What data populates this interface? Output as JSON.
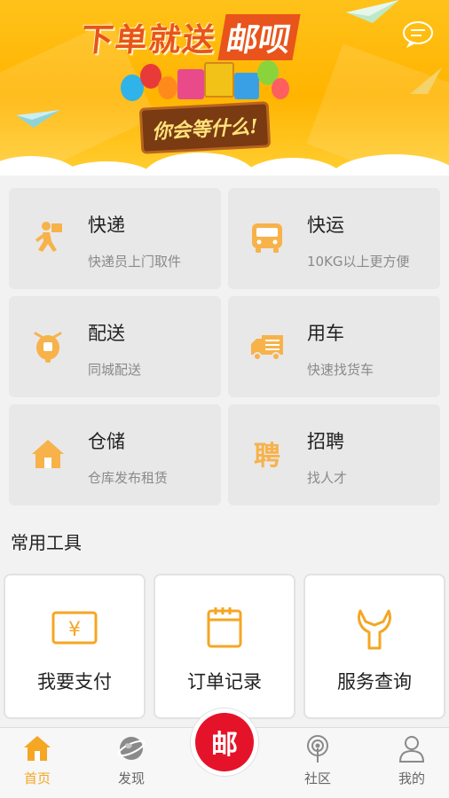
{
  "banner": {
    "title_part1": "下单就送",
    "title_part2": "邮呗",
    "board_text": "你会等什么!"
  },
  "services": [
    {
      "title": "快递",
      "subtitle": "快递员上门取件",
      "icon": "courier-icon"
    },
    {
      "title": "快运",
      "subtitle": "10KG以上更方便",
      "icon": "bus-icon"
    },
    {
      "title": "配送",
      "subtitle": "同城配送",
      "icon": "scooter-icon"
    },
    {
      "title": "用车",
      "subtitle": "快速找货车",
      "icon": "truck-icon"
    },
    {
      "title": "仓储",
      "subtitle": "仓库发布租赁",
      "icon": "house-icon"
    },
    {
      "title": "招聘",
      "subtitle": "找人才",
      "icon": "hire-icon"
    }
  ],
  "tools": {
    "section_title": "常用工具",
    "items": [
      {
        "label": "我要支付",
        "icon": "yen-icon"
      },
      {
        "label": "订单记录",
        "icon": "calendar-icon"
      },
      {
        "label": "服务查询",
        "icon": "wrench-icon"
      }
    ]
  },
  "tabbar": {
    "items": [
      {
        "label": "首页",
        "icon": "home-icon",
        "active": true
      },
      {
        "label": "发现",
        "icon": "globe-icon"
      },
      {
        "label": "社区",
        "icon": "broadcast-icon"
      },
      {
        "label": "我的",
        "icon": "user-icon"
      }
    ],
    "center_label": "邮"
  },
  "colors": {
    "accent": "#f5a623",
    "icon": "#f7b24a",
    "center_button": "#e5132a",
    "banner": "#ffb400"
  }
}
